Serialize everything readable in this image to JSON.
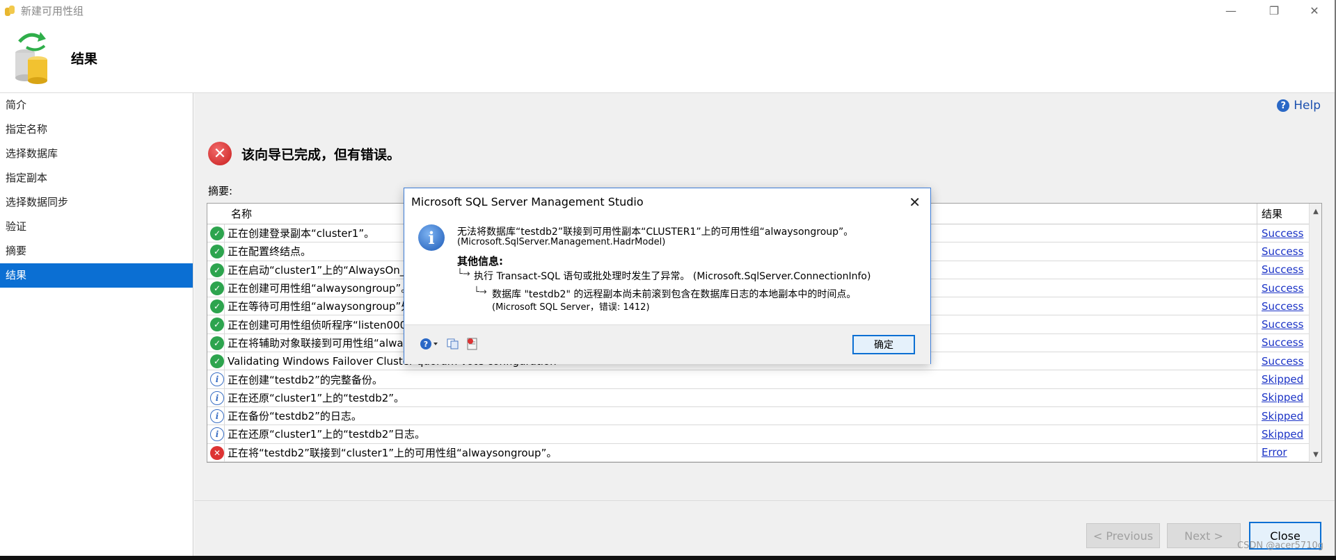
{
  "window": {
    "title": "新建可用性组",
    "controls": {
      "minimize": "—",
      "restore": "❐",
      "close": "✕"
    }
  },
  "header": {
    "title": "结果"
  },
  "sidebar": {
    "items": [
      {
        "label": "简介",
        "active": false
      },
      {
        "label": "指定名称",
        "active": false
      },
      {
        "label": "选择数据库",
        "active": false
      },
      {
        "label": "指定副本",
        "active": false
      },
      {
        "label": "选择数据同步",
        "active": false
      },
      {
        "label": "验证",
        "active": false
      },
      {
        "label": "摘要",
        "active": false
      },
      {
        "label": "结果",
        "active": true
      }
    ]
  },
  "main": {
    "help_label": "Help",
    "status_message": "该向导已完成，但有错误。",
    "summary_label": "摘要:",
    "table": {
      "columns": [
        "名称",
        "结果"
      ],
      "rows": [
        {
          "status": "success",
          "name": "正在创建登录副本“cluster1”。",
          "result": "Success"
        },
        {
          "status": "success",
          "name": "正在配置终结点。",
          "result": "Success"
        },
        {
          "status": "success",
          "name": "正在启动“cluster1”上的“AlwaysOn_he",
          "result": "Success"
        },
        {
          "status": "success",
          "name": "正在创建可用性组“alwaysongroup”。",
          "result": "Success"
        },
        {
          "status": "success",
          "name": "正在等待可用性组“alwaysongroup”处",
          "result": "Success"
        },
        {
          "status": "success",
          "name": "正在创建可用性组侦听程序“listen0001",
          "result": "Success"
        },
        {
          "status": "success",
          "name": "正在将辅助对象联接到可用性组“alway",
          "result": "Success"
        },
        {
          "status": "success",
          "name": "Validating Windows Failover Cluster quorum vote configuration",
          "result": "Success"
        },
        {
          "status": "info",
          "name": "正在创建“testdb2”的完整备份。",
          "result": "Skipped"
        },
        {
          "status": "info",
          "name": "正在还原“cluster1”上的“testdb2”。",
          "result": "Skipped"
        },
        {
          "status": "info",
          "name": "正在备份“testdb2”的日志。",
          "result": "Skipped"
        },
        {
          "status": "info",
          "name": "正在还原“cluster1”上的“testdb2”日志。",
          "result": "Skipped"
        },
        {
          "status": "error",
          "name": "正在将“testdb2”联接到“cluster1”上的可用性组“alwaysongroup”。",
          "result": "Error"
        }
      ]
    }
  },
  "footer": {
    "previous": "< Previous",
    "next": "Next >",
    "close": "Close"
  },
  "dialog": {
    "title": "Microsoft SQL Server Management Studio",
    "line1": "无法将数据库“testdb2”联接到可用性副本“CLUSTER1”上的可用性组“alwaysongroup”。",
    "line1_source": "(Microsoft.SqlServer.Management.HadrModel)",
    "more_info_label": "其他信息:",
    "line2": "执行 Transact-SQL 语句或批处理时发生了异常。 (Microsoft.SqlServer.ConnectionInfo)",
    "line3": "数据库 \"testdb2\" 的远程副本尚未前滚到包含在数据库日志的本地副本中的时间点。",
    "line3_source": "(Microsoft SQL Server，错误: 1412)",
    "ok_label": "确定"
  },
  "watermark": "CSDN @acer5710g"
}
